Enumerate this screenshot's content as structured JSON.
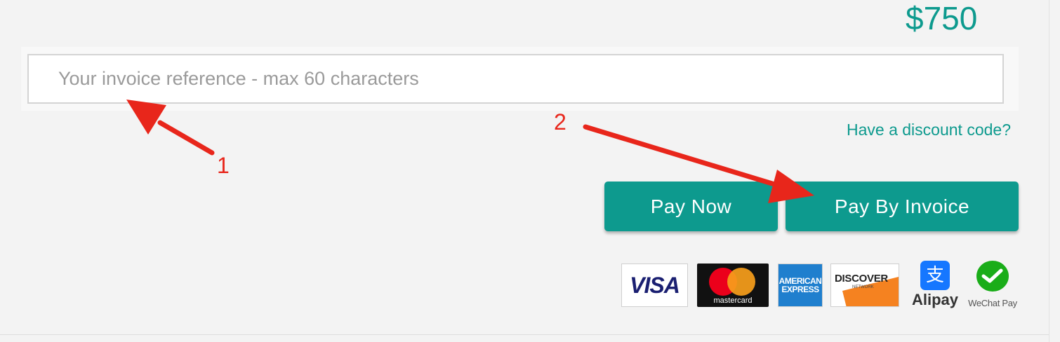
{
  "order": {
    "total": "$750"
  },
  "invoice_reference": {
    "value": "",
    "placeholder": "Your invoice reference - max 60 characters"
  },
  "discount": {
    "link_label": "Have a discount code?"
  },
  "actions": {
    "pay_now_label": "Pay Now",
    "pay_by_invoice_label": "Pay By Invoice"
  },
  "payment_methods": {
    "visa": {
      "label": "VISA",
      "icon": "visa-logo"
    },
    "mastercard": {
      "label": "mastercard",
      "icon": "mastercard-logo"
    },
    "amex": {
      "line1": "AMERICAN",
      "line2": "EXPRESS",
      "icon": "amex-logo"
    },
    "discover": {
      "label": "DISCOVER",
      "sublabel": "NETWORK",
      "icon": "discover-logo"
    },
    "alipay": {
      "label": "Alipay",
      "icon_glyph": "支",
      "icon": "alipay-logo"
    },
    "wechat": {
      "label": "WeChat Pay",
      "icon": "wechat-pay-logo"
    }
  },
  "annotations": {
    "marker_1": "1",
    "marker_2": "2"
  },
  "colors": {
    "accent": "#0d9a8e",
    "annotation": "#e8261b",
    "background": "#f3f3f3"
  }
}
